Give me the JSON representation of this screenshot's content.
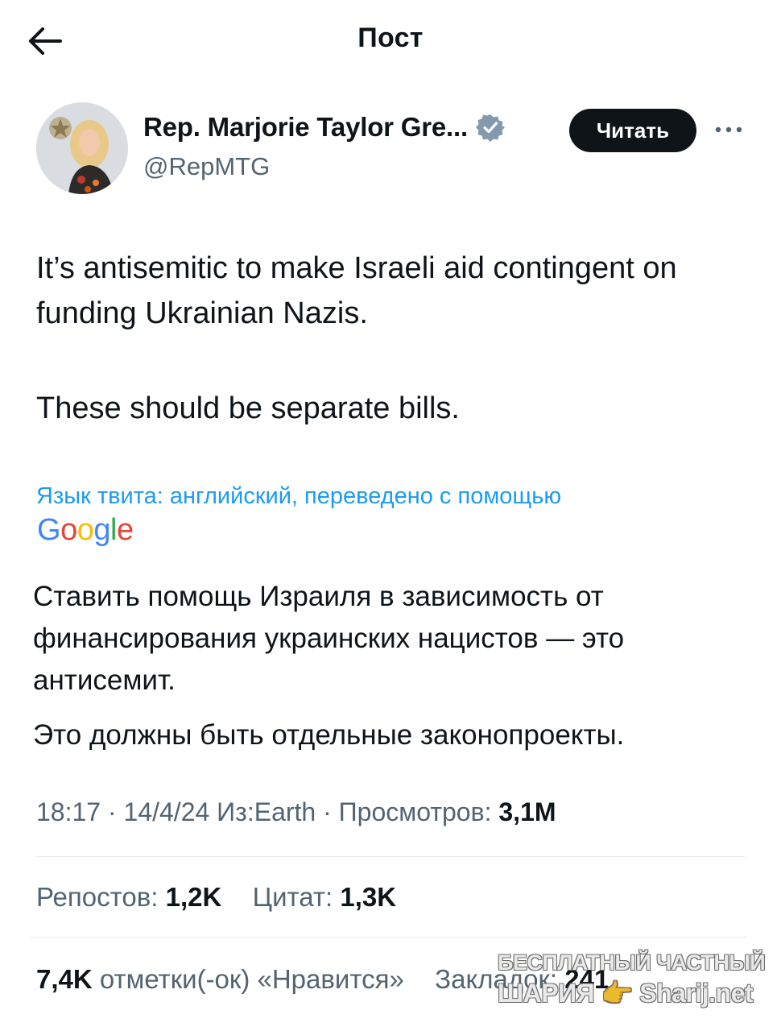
{
  "header": {
    "title": "Пост",
    "back_icon": "arrow-left-icon"
  },
  "author": {
    "display_name": "Rep. Marjorie Taylor Gre...",
    "handle": "@RepMTG",
    "verified_icon": "verified-badge-icon",
    "follow_label": "Читать",
    "more_icon": "more-horizontal-icon"
  },
  "tweet": {
    "paragraphs": [
      "It’s antisemitic to make Israeli aid contingent on funding Ukrainian Nazis.",
      "These should be separate bills."
    ]
  },
  "translation": {
    "note": "Язык твита: английский, переведено с помощью",
    "provider": "Google",
    "paragraphs": [
      "Ставить помощь Израиля в зависимость от финансирования украинских нацистов — это антисемит.",
      "Это должны быть отдельные законопроекты."
    ]
  },
  "meta": {
    "time": "18:17",
    "date": "14/4/24",
    "source": "Из:Earth",
    "views_label": "Просмотров:",
    "views": "3,1M"
  },
  "stats": {
    "reposts_count": "1,2K",
    "reposts_label": "Репостов:",
    "quotes_count": "1,3K",
    "quotes_label": "Цитат:",
    "likes_count": "7,4K",
    "likes_label": "отметки(-ок) «Нравится»",
    "bookmarks_label": "Закладок:",
    "bookmarks_count": "241"
  },
  "watermark": {
    "line1": "БЕСПЛАТНЫЙ ЧАСТНЫЙ",
    "line2": "ШАРИЯ 👉 Sharij.net"
  },
  "colors": {
    "text": "#0f1419",
    "secondary": "#536471",
    "link": "#1d9bf0",
    "verified": "#829aab",
    "divider": "#e6e9eb"
  }
}
